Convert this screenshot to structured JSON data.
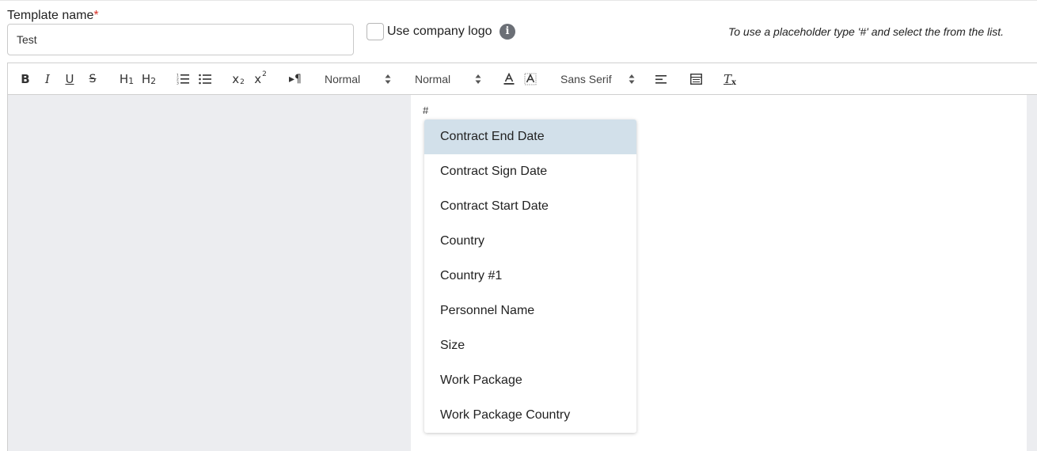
{
  "form": {
    "template_label": "Template name",
    "required_mark": "*",
    "template_value": "Test",
    "use_logo_label": "Use company logo",
    "info_glyph": "i",
    "hint_text": "To use a placeholder type '#' and select the from the list."
  },
  "toolbar": {
    "bold": "B",
    "italic": "I",
    "underline": "U",
    "strike": "S",
    "h1": "H",
    "h1_num": "1",
    "h2": "H",
    "h2_num": "2",
    "subscript_letter": "x",
    "subscript_num": "2",
    "superscript_letter": "x",
    "superscript_num": "2",
    "direction": "▸¶",
    "size_select": "Normal",
    "header_select": "Normal",
    "font_select": "Sans Serif",
    "clean": "T",
    "clean_x": "x",
    "icons": [
      "bold-icon",
      "italic-icon",
      "underline-icon",
      "strikethrough-icon",
      "heading-1-icon",
      "heading-2-icon",
      "ordered-list-icon",
      "bullet-list-icon",
      "subscript-icon",
      "superscript-icon",
      "text-direction-icon",
      "font-color-icon",
      "background-color-icon",
      "align-icon",
      "table-icon",
      "clear-format-icon"
    ]
  },
  "editor": {
    "content": "#"
  },
  "dropdown": {
    "items": [
      "Contract End Date",
      "Contract Sign Date",
      "Contract Start Date",
      "Country",
      "Country #1",
      "Personnel Name",
      "Size",
      "Work Package",
      "Work Package Country"
    ],
    "active_index": 0
  },
  "colors": {
    "required": "#d9342b",
    "active_item_bg": "#d2e0ea",
    "editor_bg": "#ecedf0",
    "info_icon_bg": "#6b6f76"
  }
}
